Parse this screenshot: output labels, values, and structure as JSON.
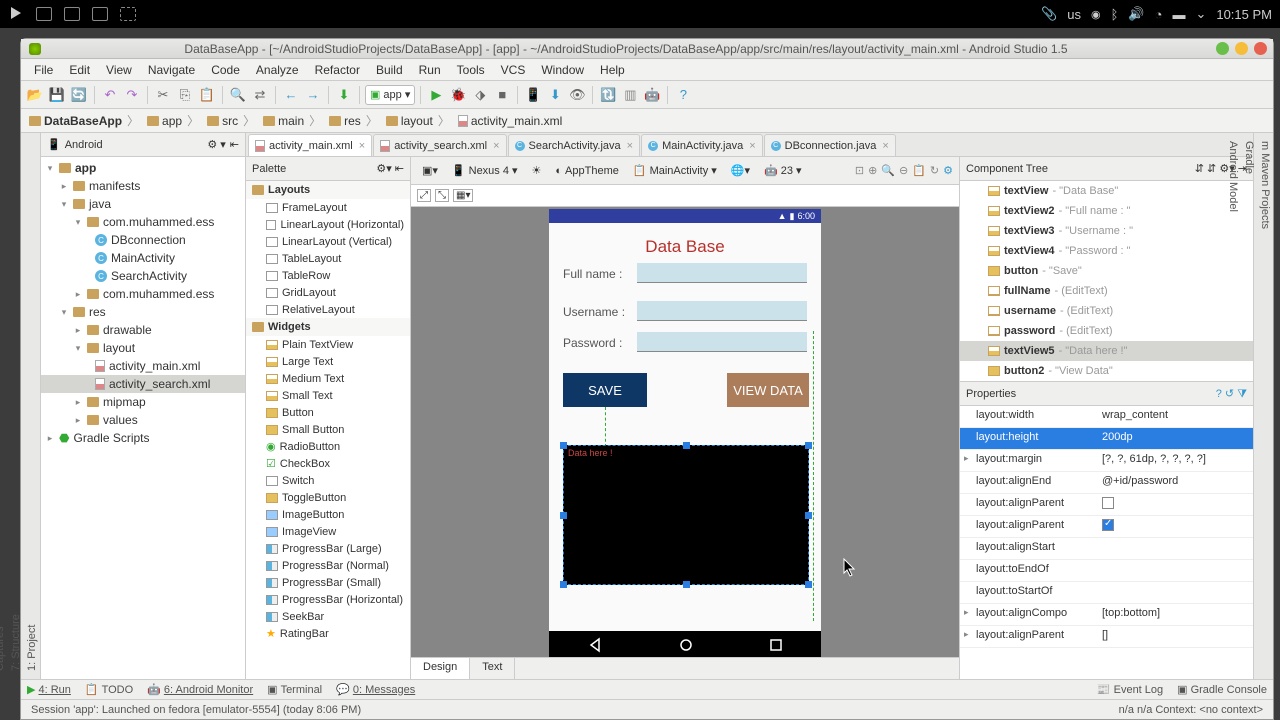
{
  "gnome": {
    "lang": "us",
    "time": "10:15 PM"
  },
  "titlebar": "DataBaseApp - [~/AndroidStudioProjects/DataBaseApp] - [app] - ~/AndroidStudioProjects/DataBaseApp/app/src/main/res/layout/activity_main.xml - Android Studio 1.5",
  "menu": [
    "File",
    "Edit",
    "View",
    "Navigate",
    "Code",
    "Analyze",
    "Refactor",
    "Build",
    "Run",
    "Tools",
    "VCS",
    "Window",
    "Help"
  ],
  "breadcrumb": [
    "DataBaseApp",
    "app",
    "src",
    "main",
    "res",
    "layout",
    "activity_main.xml"
  ],
  "project_dropdown": "Android",
  "project": {
    "root": "app",
    "manifests": "manifests",
    "java": "java",
    "pkg": "com.muhammed.ess",
    "files_a": [
      "DBconnection",
      "MainActivity",
      "SearchActivity"
    ],
    "pkg2": "com.muhammed.ess",
    "res": "res",
    "drawable": "drawable",
    "layout": "layout",
    "layouts": [
      "activity_main.xml",
      "activity_search.xml"
    ],
    "mipmap": "mipmap",
    "values": "values",
    "gradle": "Gradle Scripts"
  },
  "tabs": [
    {
      "name": "activity_main.xml",
      "kind": "xml",
      "active": true
    },
    {
      "name": "activity_search.xml",
      "kind": "xml"
    },
    {
      "name": "SearchActivity.java",
      "kind": "java"
    },
    {
      "name": "MainActivity.java",
      "kind": "java"
    },
    {
      "name": "DBconnection.java",
      "kind": "java"
    }
  ],
  "palette": {
    "title": "Palette",
    "layouts_h": "Layouts",
    "layouts": [
      "FrameLayout",
      "LinearLayout (Horizontal)",
      "LinearLayout (Vertical)",
      "TableLayout",
      "TableRow",
      "GridLayout",
      "RelativeLayout"
    ],
    "widgets_h": "Widgets",
    "widgets": [
      "Plain TextView",
      "Large Text",
      "Medium Text",
      "Small Text",
      "Button",
      "Small Button",
      "RadioButton",
      "CheckBox",
      "Switch",
      "ToggleButton",
      "ImageButton",
      "ImageView",
      "ProgressBar (Large)",
      "ProgressBar (Normal)",
      "ProgressBar (Small)",
      "ProgressBar (Horizontal)",
      "SeekBar",
      "RatingBar"
    ]
  },
  "canvas_bar": {
    "device": "Nexus 4",
    "theme": "AppTheme",
    "activity": "MainActivity",
    "api": "23"
  },
  "phone": {
    "time": "6:00",
    "title": "Data Base",
    "lbl_full": "Full name :",
    "lbl_user": "Username :",
    "lbl_pass": "Password :",
    "btn_save": "SAVE",
    "btn_view": "VIEW DATA",
    "datahere": "Data here !"
  },
  "comptree": {
    "title": "Component Tree",
    "items": [
      {
        "n": "textView",
        "d": "\"Data Base\"",
        "k": "t"
      },
      {
        "n": "textView2",
        "d": "\"Full name : \"",
        "k": "t"
      },
      {
        "n": "textView3",
        "d": "\"Username : \"",
        "k": "t"
      },
      {
        "n": "textView4",
        "d": "\"Password : \"",
        "k": "t"
      },
      {
        "n": "button",
        "d": "\"Save\"",
        "k": "b"
      },
      {
        "n": "fullName",
        "d": "(EditText)",
        "k": "e"
      },
      {
        "n": "username",
        "d": "(EditText)",
        "k": "e"
      },
      {
        "n": "password",
        "d": "(EditText)",
        "k": "e"
      },
      {
        "n": "textView5",
        "d": "\"Data here !\"",
        "k": "t",
        "sel": true
      },
      {
        "n": "button2",
        "d": "\"View Data\"",
        "k": "b"
      }
    ]
  },
  "props": {
    "title": "Properties",
    "rows": [
      {
        "n": "layout:width",
        "v": "wrap_content"
      },
      {
        "n": "layout:height",
        "v": "200dp",
        "sel": true
      },
      {
        "n": "layout:margin",
        "v": "[?, ?, 61dp, ?, ?, ?, ?]",
        "exp": true
      },
      {
        "n": "layout:alignEnd",
        "v": "@+id/password"
      },
      {
        "n": "layout:alignParent",
        "v": "",
        "chk": false
      },
      {
        "n": "layout:alignParent",
        "v": "",
        "chk": true
      },
      {
        "n": "layout:alignStart",
        "v": ""
      },
      {
        "n": "layout:toEndOf",
        "v": ""
      },
      {
        "n": "layout:toStartOf",
        "v": ""
      },
      {
        "n": "layout:alignCompo",
        "v": "[top:bottom]",
        "exp": true
      },
      {
        "n": "layout:alignParent",
        "v": "[]",
        "exp": true
      }
    ]
  },
  "design_tabs": [
    "Design",
    "Text"
  ],
  "bottom": {
    "run": "4: Run",
    "todo": "TODO",
    "monitor": "6: Android Monitor",
    "terminal": "Terminal",
    "messages": "0: Messages",
    "eventlog": "Event Log",
    "gradle": "Gradle Console"
  },
  "status": "Session 'app': Launched on fedora [emulator-5554] (today 8:06 PM)",
  "status_r": "n/a   n/a   Context: <no context>"
}
